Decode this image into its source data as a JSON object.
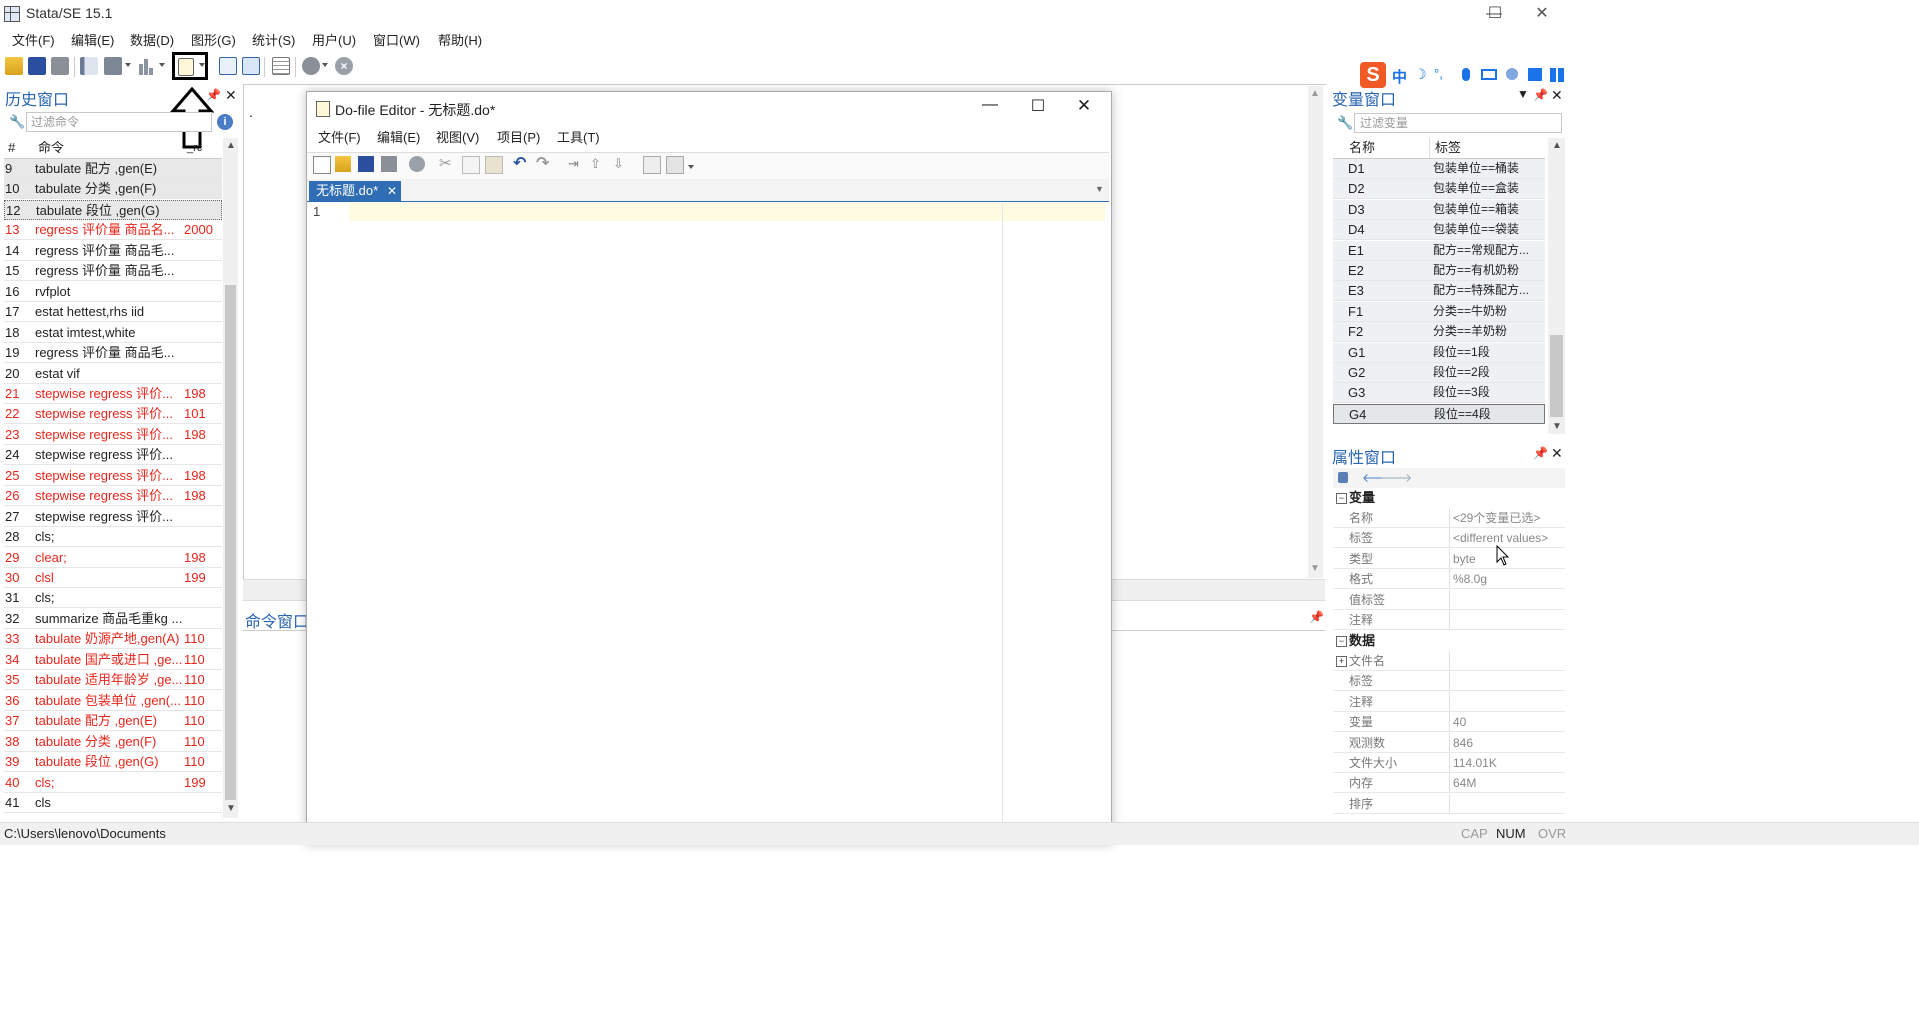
{
  "window": {
    "title": "Stata/SE 15.1",
    "controls": {
      "minimize": "—",
      "maximize": "☐",
      "close": "✕"
    }
  },
  "menu": [
    "文件(F)",
    "编辑(E)",
    "数据(D)",
    "图形(G)",
    "统计(S)",
    "用户(U)",
    "窗口(W)",
    "帮助(H)"
  ],
  "toolbar": {
    "icons": [
      "open-icon",
      "save-icon",
      "print-icon",
      "log-icon",
      "viewer-icon",
      "graph-icon",
      "do-editor-icon",
      "data-editor-icon",
      "data-browser-icon",
      "variables-manager-icon",
      "more-icon",
      "break-icon"
    ],
    "highlighted": "do-editor-icon"
  },
  "history": {
    "title": "历史窗口",
    "filter_placeholder": "过滤命令",
    "col_num": "#",
    "col_cmd": "命令",
    "col_rc": "_rc",
    "rows": [
      {
        "n": "9",
        "cmd": "tabulate 配方 ,gen(E)",
        "rc": "",
        "error": false
      },
      {
        "n": "10",
        "cmd": "tabulate 分类 ,gen(F)",
        "rc": "",
        "error": false
      },
      {
        "n": "12",
        "cmd": "tabulate 段位 ,gen(G)",
        "rc": "",
        "error": false
      },
      {
        "n": "13",
        "cmd": "regress 评价量 商品名...",
        "rc": "2000",
        "error": true
      },
      {
        "n": "14",
        "cmd": "regress 评价量 商品毛...",
        "rc": "",
        "error": false
      },
      {
        "n": "15",
        "cmd": "regress 评价量 商品毛...",
        "rc": "",
        "error": false
      },
      {
        "n": "16",
        "cmd": "rvfplot",
        "rc": "",
        "error": false
      },
      {
        "n": "17",
        "cmd": "estat hettest,rhs iid",
        "rc": "",
        "error": false
      },
      {
        "n": "18",
        "cmd": "estat imtest,white",
        "rc": "",
        "error": false
      },
      {
        "n": "19",
        "cmd": "regress 评价量 商品毛...",
        "rc": "",
        "error": false
      },
      {
        "n": "20",
        "cmd": "estat vif",
        "rc": "",
        "error": false
      },
      {
        "n": "21",
        "cmd": "stepwise regress 评价...",
        "rc": "198",
        "error": true
      },
      {
        "n": "22",
        "cmd": "stepwise regress 评价...",
        "rc": "101",
        "error": true
      },
      {
        "n": "23",
        "cmd": "stepwise regress 评价...",
        "rc": "198",
        "error": true
      },
      {
        "n": "24",
        "cmd": "stepwise regress 评价...",
        "rc": "",
        "error": false
      },
      {
        "n": "25",
        "cmd": "stepwise regress 评价...",
        "rc": "198",
        "error": true
      },
      {
        "n": "26",
        "cmd": "stepwise regress 评价...",
        "rc": "198",
        "error": true
      },
      {
        "n": "27",
        "cmd": "stepwise regress 评价...",
        "rc": "",
        "error": false
      },
      {
        "n": "28",
        "cmd": "cls;",
        "rc": "",
        "error": false
      },
      {
        "n": "29",
        "cmd": "clear;",
        "rc": "198",
        "error": true
      },
      {
        "n": "30",
        "cmd": "clsl",
        "rc": "199",
        "error": true
      },
      {
        "n": "31",
        "cmd": "cls;",
        "rc": "",
        "error": false
      },
      {
        "n": "32",
        "cmd": "summarize 商品毛重kg ...",
        "rc": "",
        "error": false
      },
      {
        "n": "33",
        "cmd": "tabulate 奶源产地,gen(A)",
        "rc": "110",
        "error": true
      },
      {
        "n": "34",
        "cmd": "tabulate 国产或进口 ,ge...",
        "rc": "110",
        "error": true
      },
      {
        "n": "35",
        "cmd": "tabulate 适用年龄岁 ,ge...",
        "rc": "110",
        "error": true
      },
      {
        "n": "36",
        "cmd": "tabulate 包装单位 ,gen(...",
        "rc": "110",
        "error": true
      },
      {
        "n": "37",
        "cmd": "tabulate 配方 ,gen(E)",
        "rc": "110",
        "error": true
      },
      {
        "n": "38",
        "cmd": "tabulate 分类 ,gen(F)",
        "rc": "110",
        "error": true
      },
      {
        "n": "39",
        "cmd": "tabulate 段位 ,gen(G)",
        "rc": "110",
        "error": true
      },
      {
        "n": "40",
        "cmd": "cls;",
        "rc": "199",
        "error": true
      },
      {
        "n": "41",
        "cmd": "cls",
        "rc": "",
        "error": false
      }
    ]
  },
  "results": {
    "dot": "."
  },
  "command_window": {
    "title": "命令窗口"
  },
  "editor": {
    "title": "Do-file Editor - 无标题.do*",
    "menu": [
      "文件(F)",
      "编辑(E)",
      "视图(V)",
      "项目(P)",
      "工具(T)"
    ],
    "tab_label": "无标题.do*",
    "line_number": "1"
  },
  "variables": {
    "title": "变量窗口",
    "filter_placeholder": "过滤变量",
    "col_name": "名称",
    "col_label": "标签",
    "rows": [
      {
        "name": "D1",
        "label": "包装单位==桶装"
      },
      {
        "name": "D2",
        "label": "包装单位==盒装"
      },
      {
        "name": "D3",
        "label": "包装单位==箱装"
      },
      {
        "name": "D4",
        "label": "包装单位==袋装"
      },
      {
        "name": "E1",
        "label": "配方==常规配方..."
      },
      {
        "name": "E2",
        "label": "配方==有机奶粉"
      },
      {
        "name": "E3",
        "label": "配方==特殊配方..."
      },
      {
        "name": "F1",
        "label": "分类==牛奶粉"
      },
      {
        "name": "F2",
        "label": "分类==羊奶粉"
      },
      {
        "name": "G1",
        "label": "段位==1段"
      },
      {
        "name": "G2",
        "label": "段位==2段"
      },
      {
        "name": "G3",
        "label": "段位==3段"
      },
      {
        "name": "G4",
        "label": "段位==4段"
      }
    ]
  },
  "properties": {
    "title": "属性窗口",
    "section_variable": "变量",
    "variable_rows": [
      {
        "key": "名称",
        "value": "<29个变量已选>"
      },
      {
        "key": "标签",
        "value": "<different values>"
      },
      {
        "key": "类型",
        "value": "byte"
      },
      {
        "key": "格式",
        "value": "%8.0g"
      },
      {
        "key": "值标签",
        "value": ""
      },
      {
        "key": "注释",
        "value": ""
      }
    ],
    "section_data": "数据",
    "data_rows": [
      {
        "key": "文件名",
        "value": "",
        "expandable": true
      },
      {
        "key": "标签",
        "value": ""
      },
      {
        "key": "注释",
        "value": ""
      },
      {
        "key": "变量",
        "value": "40"
      },
      {
        "key": "观测数",
        "value": "846"
      },
      {
        "key": "文件大小",
        "value": "114.01K"
      },
      {
        "key": "内存",
        "value": "64M"
      },
      {
        "key": "排序",
        "value": ""
      }
    ]
  },
  "ime": {
    "items": [
      "S",
      "中",
      "☽",
      "°,",
      "🎤",
      "⌨",
      "👤",
      "👕",
      "▦"
    ]
  },
  "status": {
    "path": "C:\\Users\\lenovo\\Documents",
    "cap": "CAP",
    "num": "NUM",
    "ovr": "OVR"
  }
}
